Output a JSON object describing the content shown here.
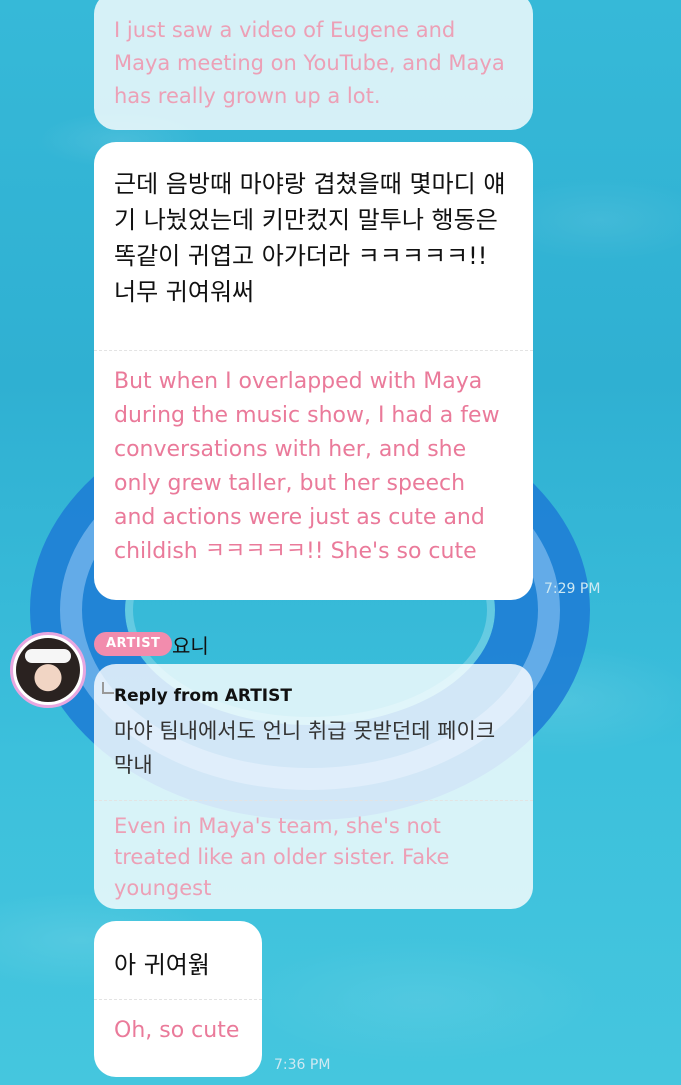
{
  "messages": [
    {
      "english": "I just saw a video of Eugene and Maya meeting on YouTube, and Maya has really grown up a lot."
    },
    {
      "korean": "근데 음방때 마야랑 겹쳤을때 몇마디 얘기 나눴었는데 키만컸지 말투나 행동은 똑같이 귀엽고 아가더라 ㅋㅋㅋㅋㅋ!! 너무 귀여워써",
      "english": "But when I overlapped with Maya during the music show, I had a few conversations with her, and she only grew taller, but her speech and actions were just as cute and childish ㅋㅋㅋㅋㅋ!! She's so cute",
      "time": "7:29 PM"
    },
    {
      "sender": "요니",
      "badge": "ARTIST",
      "reply_label": "Reply from ARTIST",
      "korean": "마야 팀내에서도 언니 취급 못받던데 페이크 막내",
      "english": "Even in Maya's team, she's not treated like an older sister. Fake youngest"
    },
    {
      "korean": "아 귀여웕",
      "english": "Oh, so cute",
      "time": "7:36 PM"
    }
  ],
  "colors": {
    "background": "#36b9d8",
    "bubble": "#ffffff",
    "translation_text": "#ea7a9a",
    "artist_badge": "#f28cad",
    "ring": "#1f7fd6"
  }
}
